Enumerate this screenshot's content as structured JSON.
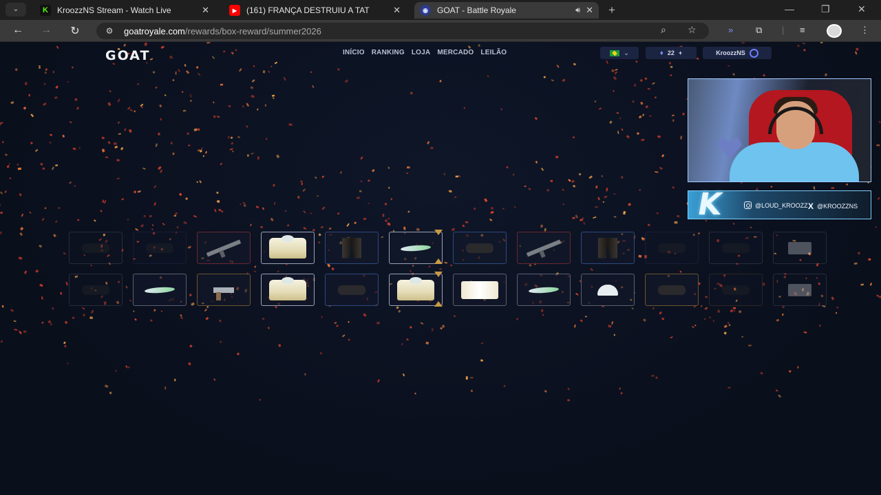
{
  "browser": {
    "tabs": [
      {
        "title": "KroozzNS Stream - Watch Live",
        "favicon": "kick-icon",
        "active": false
      },
      {
        "title": "(161) FRANÇA DESTRUIU A TAT",
        "favicon": "youtube-icon",
        "active": false
      },
      {
        "title": "GOAT - Battle Royale",
        "favicon": "goat-icon",
        "active": true,
        "audio": true
      }
    ],
    "url_host": "goatroyale.com",
    "url_path": "/rewards/box-reward/summer2026"
  },
  "site": {
    "logo": "GOAT",
    "nav": [
      "INÍCIO",
      "RANKING",
      "LOJA",
      "MERCADO",
      "LEILÃO"
    ],
    "currency_amount": "22",
    "currency_add": "+",
    "username": "KroozzNS"
  },
  "reels": [
    {
      "items": [
        {
          "item": "dark",
          "rarity": "grey",
          "faded": true
        },
        {
          "item": "dark",
          "rarity": "purple",
          "faded": true
        },
        {
          "item": "gun",
          "rarity": "red"
        },
        {
          "item": "shirt",
          "rarity": "grey",
          "selected": true
        },
        {
          "item": "pants",
          "rarity": "blue"
        },
        {
          "item": "shoes",
          "rarity": "grey",
          "selected": true
        },
        {
          "item": "dark",
          "rarity": "blue"
        },
        {
          "item": "gun",
          "rarity": "red"
        },
        {
          "item": "pants",
          "rarity": "blue"
        },
        {
          "item": "dark",
          "rarity": "purple",
          "faded": true
        },
        {
          "item": "dark",
          "rarity": "grey",
          "faded": true
        },
        {
          "item": "box",
          "rarity": "grey",
          "faded": true
        }
      ]
    },
    {
      "items": [
        {
          "item": "dark",
          "rarity": "grey",
          "faded": true
        },
        {
          "item": "shoes",
          "rarity": "grey"
        },
        {
          "item": "pistol",
          "rarity": "gold"
        },
        {
          "item": "shirt",
          "rarity": "grey",
          "selected": true
        },
        {
          "item": "dark",
          "rarity": "blue"
        },
        {
          "item": "shirt",
          "rarity": "grey",
          "selected": true
        },
        {
          "item": "shorts",
          "rarity": "grey"
        },
        {
          "item": "shoes",
          "rarity": "grey"
        },
        {
          "item": "hat",
          "rarity": "grey"
        },
        {
          "item": "dark",
          "rarity": "gold"
        },
        {
          "item": "dark",
          "rarity": "gold",
          "faded": true
        },
        {
          "item": "box",
          "rarity": "grey",
          "faded": true
        }
      ]
    }
  ],
  "overlay": {
    "instagram": "@LOUD_KROOZZ",
    "x": "@KROOZZNS",
    "logo_letter": "K"
  },
  "colors": {
    "page_bg": "#0b1020",
    "confetti": [
      "#e0482e",
      "#f07a3a",
      "#c93a2a",
      "#f2a24a",
      "#b8342a"
    ],
    "marker": "#c99a45",
    "accent": "#6e7cff"
  }
}
